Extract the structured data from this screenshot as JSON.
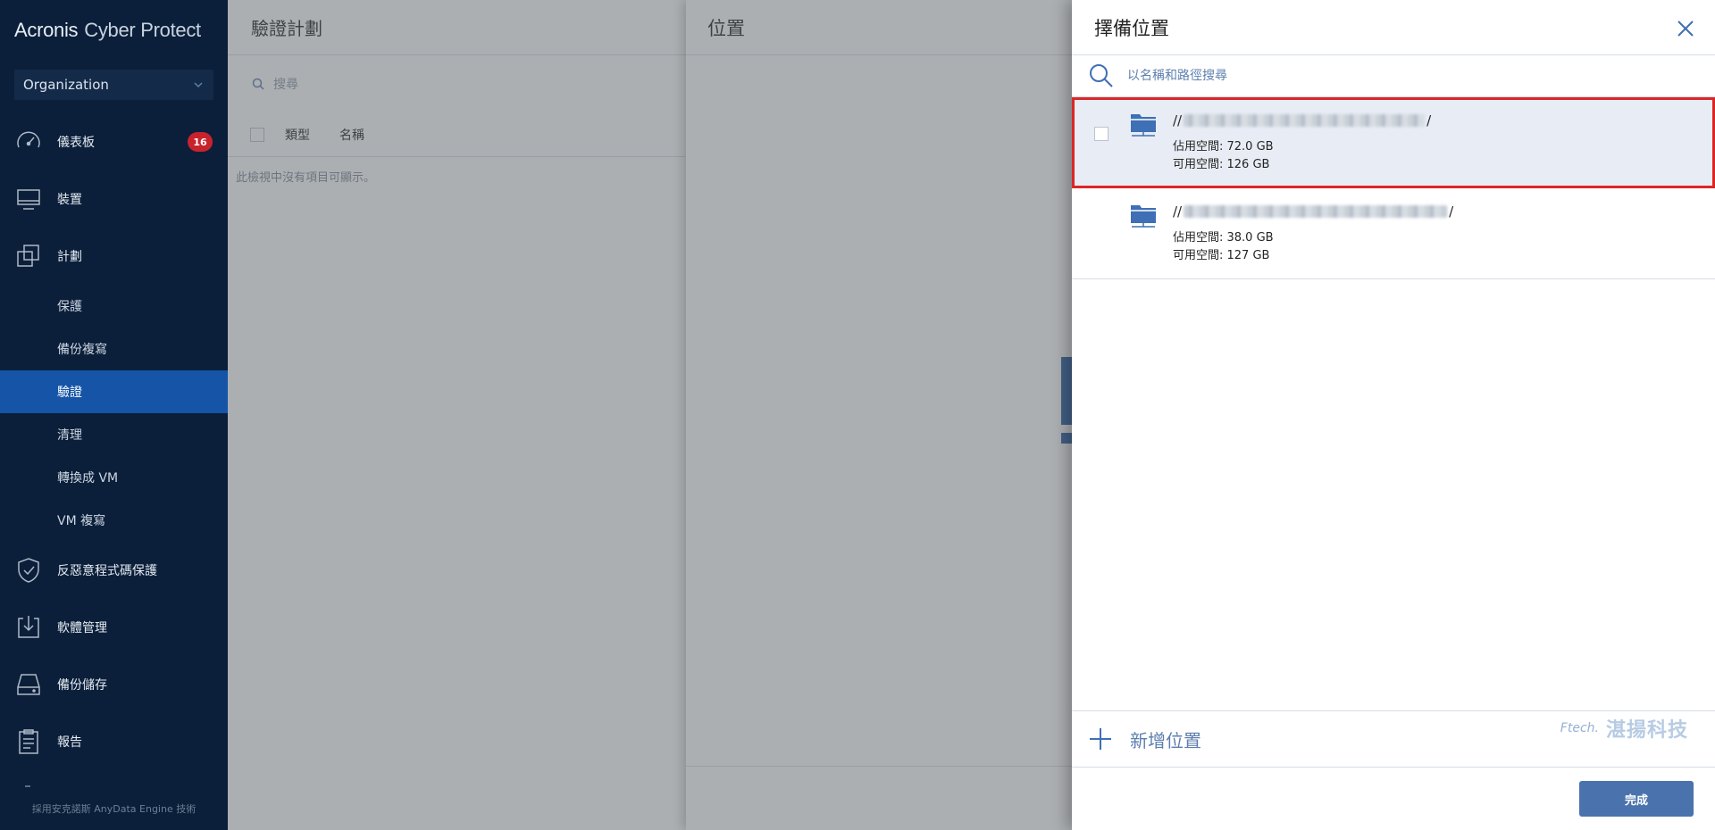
{
  "sidebar": {
    "brand_name": "Acronis",
    "brand_product": "Cyber Protect",
    "org_select": "Organization",
    "items": {
      "dashboard": {
        "label": "儀表板",
        "badge": "16",
        "icon": "dashboard-gauge-icon"
      },
      "devices": {
        "label": "裝置",
        "icon": "monitor-icon"
      },
      "plans": {
        "label": "計劃",
        "icon": "plans-copy-icon"
      },
      "anti_ransomware": {
        "label": "反惡意程式碼保護",
        "icon": "shield-check-icon"
      },
      "software": {
        "label": "軟體管理",
        "icon": "software-download-icon"
      },
      "storage": {
        "label": "備份儲存",
        "icon": "storage-drive-icon"
      },
      "reports": {
        "label": "報告",
        "icon": "clipboard-report-icon"
      }
    },
    "sub_items": [
      "保護",
      "備份複寫",
      "驗證",
      "清理",
      "轉換成 VM",
      "VM 複寫"
    ],
    "active_sub": "驗證",
    "footer": "採用安克諾斯 AnyData Engine 技術"
  },
  "page1": {
    "title": "驗證計劃",
    "search_placeholder": "搜尋",
    "columns": [
      "類型",
      "名稱"
    ],
    "empty_message": "此檢視中沒有項目可顯示。"
  },
  "page2": {
    "title": "位置"
  },
  "panel": {
    "title": "擇備位置",
    "search_placeholder": "以名稱和路徑搜尋",
    "locations": [
      {
        "path_prefix": "//",
        "path_suffix": "/",
        "used": "佔用空間: 72.0 GB",
        "free": "可用空間: 126 GB",
        "selected": true
      },
      {
        "path_prefix": "//",
        "path_suffix": "/",
        "used": "佔用空間: 38.0 GB",
        "free": "可用空間: 127 GB",
        "selected": false
      }
    ],
    "add_location": "新增位置",
    "watermark_logo": "Ftech.",
    "watermark_text": "湛揚科技",
    "done": "完成"
  },
  "colors": {
    "sidebar_bg": "#0b1f3a",
    "active_item": "#1554a6",
    "accent": "#4a72ad",
    "badge": "#c8232d",
    "highlight_border": "#dc2626",
    "selected_row": "#e8edf5"
  }
}
